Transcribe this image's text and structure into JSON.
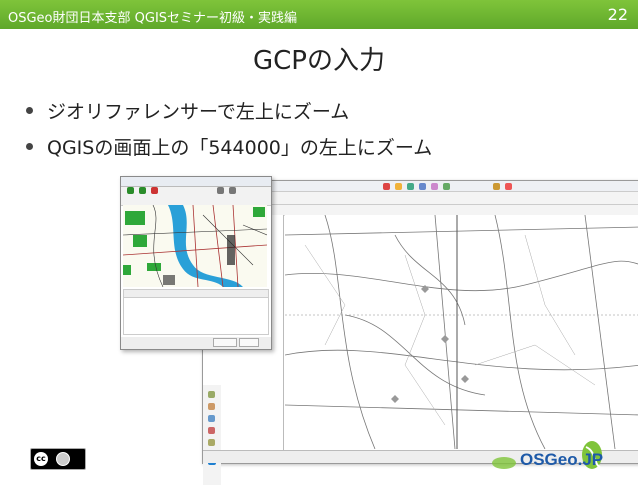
{
  "header": {
    "left_text": "OSGeo財団日本支部 QGISセミナー初級・実践編",
    "page_number": "22"
  },
  "slide": {
    "title": "GCPの入力",
    "bullets": [
      "ジオリファレンサーで左上にズーム",
      "QGISの画面上の「544000」の左上にズーム"
    ]
  },
  "footer": {
    "license_icon": "creative-commons-by-icon",
    "logo_text": "OSGeo.JP"
  },
  "colors": {
    "header_green": "#6fb632",
    "logo_blue": "#1e5aa8",
    "logo_green": "#7fc43a"
  }
}
